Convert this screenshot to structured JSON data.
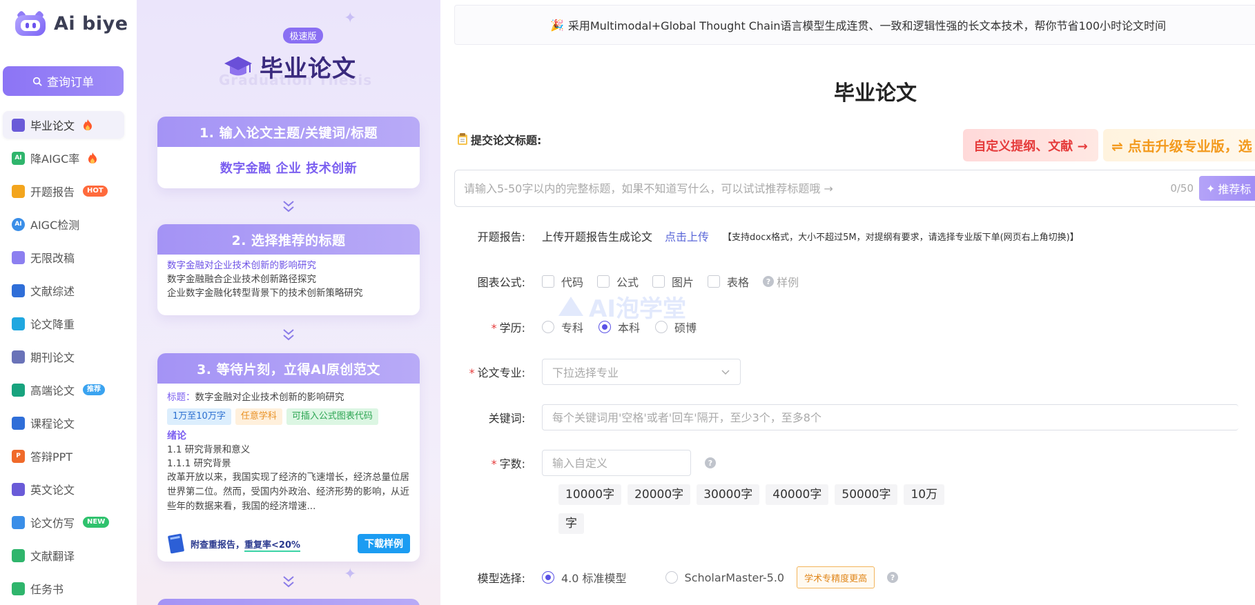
{
  "brand": {
    "name": "Ai biye"
  },
  "sidebar": {
    "search_label": "查询订单",
    "items": [
      {
        "label": "毕业论文",
        "icon": "graduation-cap-icon",
        "color": "#6a5bd8",
        "badge": "",
        "flame": true,
        "active": true
      },
      {
        "label": "降AIGC率",
        "icon": "ai-chip-icon",
        "color": "#2fb56c",
        "badge": "",
        "flame": true
      },
      {
        "label": "开题报告",
        "icon": "report-icon",
        "color": "#f3a51d",
        "badge": "HOT",
        "badge_type": "hot"
      },
      {
        "label": "AIGC检测",
        "icon": "ai-detect-icon",
        "color": "#3a8ee8",
        "badge": ""
      },
      {
        "label": "无限改稿",
        "icon": "infinity-icon",
        "color": "#8c7ff0",
        "badge": ""
      },
      {
        "label": "文献综述",
        "icon": "book-icon",
        "color": "#2f6ed8",
        "badge": ""
      },
      {
        "label": "论文降重",
        "icon": "chart-down-icon",
        "color": "#1fa7e0",
        "badge": ""
      },
      {
        "label": "期刊论文",
        "icon": "journal-icon",
        "color": "#6a73b8",
        "badge": ""
      },
      {
        "label": "高端论文",
        "icon": "openai-icon",
        "color": "#18a37e",
        "badge": "推荐",
        "badge_type": "rec"
      },
      {
        "label": "课程论文",
        "icon": "course-icon",
        "color": "#2f6ed8",
        "badge": ""
      },
      {
        "label": "答辩PPT",
        "icon": "ppt-icon",
        "color": "#f06a2a",
        "badge": ""
      },
      {
        "label": "英文论文",
        "icon": "graduation-cap-icon",
        "color": "#6a5bd8",
        "badge": ""
      },
      {
        "label": "论文仿写",
        "icon": "edit-icon",
        "color": "#3a8ee8",
        "badge": "NEW",
        "badge_type": "new"
      },
      {
        "label": "文献翻译",
        "icon": "translate-icon",
        "color": "#2fb56c",
        "badge": ""
      },
      {
        "label": "任务书",
        "icon": "task-icon",
        "color": "#2fb56c",
        "badge": ""
      }
    ]
  },
  "promo": {
    "tag": "极速版",
    "title": "毕业论文",
    "subtitle_en": "Graduation Thesis",
    "step1": {
      "head": "1. 输入论文主题/关键词/标题",
      "keywords": "数字金融  企业  技术创新"
    },
    "step2": {
      "head": "2. 选择推荐的标题",
      "titles": [
        "数字金融对企业技术创新的影响研究",
        "数字金融融合企业技术创新路径探究",
        "企业数字金融化转型背景下的技术创新策略研究"
      ]
    },
    "step3": {
      "head": "3. 等待片刻，立得AI原创范文",
      "title_label": "标题：",
      "title_value": "数字金融对企业技术创新的影响研究",
      "chips": [
        "1万至10万字",
        "任意学科",
        "可插入公式图表代码"
      ],
      "section": "绪论",
      "lines": [
        "1.1 研究背景和意义",
        "1.1.1 研究背景"
      ],
      "paragraph": "改革开放以来，我国实现了经济的飞速增长，经济总量位居世界第二位。然而，受国内外政治、经济形势的影响，从近些年的数据来看，我国的经济增速...",
      "footer_prefix": "附查重报告，",
      "footer_underline": "重复率<20%",
      "download": "下载样例"
    }
  },
  "main": {
    "banner": "采用Multimodal+Global Thought Chain语言模型生成连贯、一致和逻辑性强的长文本技术，帮你节省100小时论文时间",
    "title": "毕业论文",
    "submit_label": "提交论文标题:",
    "upgrade_custom": "自定义提纲、文献 →",
    "upgrade_pro": "⇌ 点击升级专业版，选",
    "title_input": {
      "placeholder": "请输入5-50字以内的完整标题，如果不知道写什么，可以试试推荐标题哦 →",
      "counter": "0/50",
      "recommend": "推荐标"
    },
    "proposal": {
      "label": "开题报告:",
      "text": "上传开题报告生成论文",
      "link": "点击上传",
      "hint": "【支持docx格式，大小不超过5M，对提纲有要求，请选择专业版下单(网页右上角切换)】"
    },
    "figures": {
      "label": "图表公式:",
      "options": [
        "代码",
        "公式",
        "图片",
        "表格"
      ],
      "example": "样例"
    },
    "degree": {
      "label": "学历:",
      "options": [
        "专科",
        "本科",
        "硕博"
      ],
      "selected": 1
    },
    "major": {
      "label": "论文专业:",
      "placeholder": "下拉选择专业"
    },
    "keywords": {
      "label": "关键词:",
      "placeholder": "每个关键词用'空格'或者'回车'隔开，至少3个，至多8个"
    },
    "word_count": {
      "label": "字数:",
      "placeholder": "输入自定义",
      "options": [
        "10000字",
        "20000字",
        "30000字",
        "40000字",
        "50000字",
        "10万",
        "字"
      ]
    },
    "model": {
      "label": "模型选择:",
      "options": [
        "4.0 标准模型",
        "ScholarMaster-5.0"
      ],
      "selected": 0,
      "tag": "学术专精度更高"
    },
    "watermark": "AI泡学堂"
  },
  "colors": {
    "accent": "#8c74f5",
    "selected_radio": "#5a52e6",
    "hot": "#ff6a3c",
    "danger": "#e53b3b",
    "link": "#5a67d8"
  }
}
